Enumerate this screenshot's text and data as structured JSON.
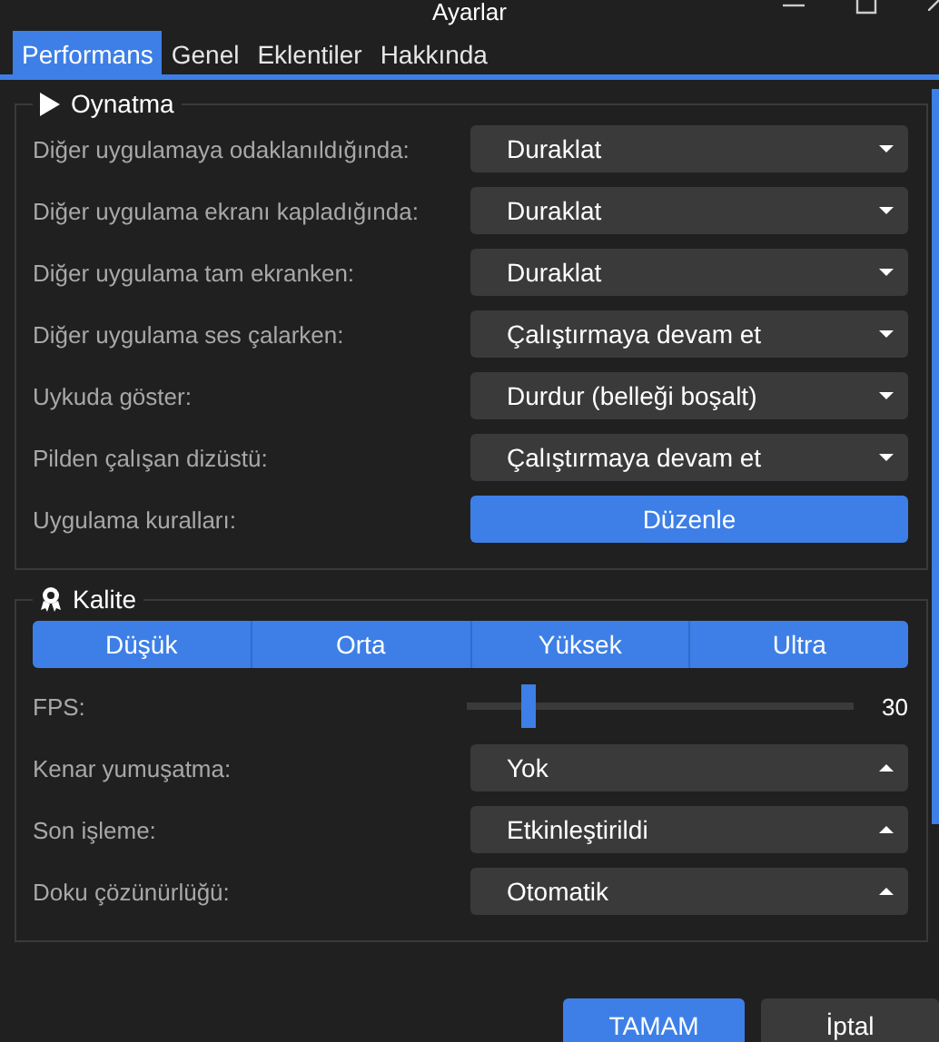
{
  "window": {
    "title": "Ayarlar"
  },
  "tabs": [
    {
      "label": "Performans",
      "selected": true
    },
    {
      "label": "Genel",
      "selected": false
    },
    {
      "label": "Eklentiler",
      "selected": false
    },
    {
      "label": "Hakkında",
      "selected": false
    }
  ],
  "sections": [
    {
      "title": "Oynatma",
      "rows": [
        {
          "kind": "select",
          "label": "Diğer uygulamaya odaklanıldığında:",
          "value": "Duraklat",
          "expanded": false
        },
        {
          "kind": "select",
          "label": "Diğer uygulama ekranı kapladığında:",
          "value": "Duraklat",
          "expanded": false
        },
        {
          "kind": "select",
          "label": "Diğer uygulama tam ekranken:",
          "value": "Duraklat",
          "expanded": false
        },
        {
          "kind": "select",
          "label": "Diğer uygulama ses çalarken:",
          "value": "Çalıştırmaya devam et",
          "expanded": false
        },
        {
          "kind": "select",
          "label": "Uykuda göster:",
          "value": "Durdur (belleği boşalt)",
          "expanded": false
        },
        {
          "kind": "select",
          "label": "Pilden çalışan dizüstü:",
          "value": "Çalıştırmaya devam et",
          "expanded": false
        },
        {
          "kind": "button",
          "label": "Uygulama kuralları:",
          "value": "Düzenle"
        }
      ]
    },
    {
      "title": "Kalite",
      "rows": [
        {
          "kind": "segments",
          "options": [
            {
              "label": "Düşük",
              "selected": false
            },
            {
              "label": "Orta",
              "selected": false
            },
            {
              "label": "Yüksek",
              "selected": false
            },
            {
              "label": "Ultra",
              "selected": false
            }
          ]
        },
        {
          "kind": "slider",
          "label": "FPS:",
          "level": 0.16,
          "reading": "30"
        },
        {
          "kind": "select",
          "label": "Kenar yumuşatma:",
          "value": "Yok",
          "expanded": true
        },
        {
          "kind": "select",
          "label": "Son işleme:",
          "value": "Etkinleştirildi",
          "expanded": true
        },
        {
          "kind": "select",
          "label": "Doku çözünürlüğü:",
          "value": "Otomatik",
          "expanded": true
        }
      ]
    }
  ],
  "buttons": [
    {
      "label": "TAMAM",
      "primary": true
    },
    {
      "label": "İptal",
      "primary": false
    }
  ]
}
